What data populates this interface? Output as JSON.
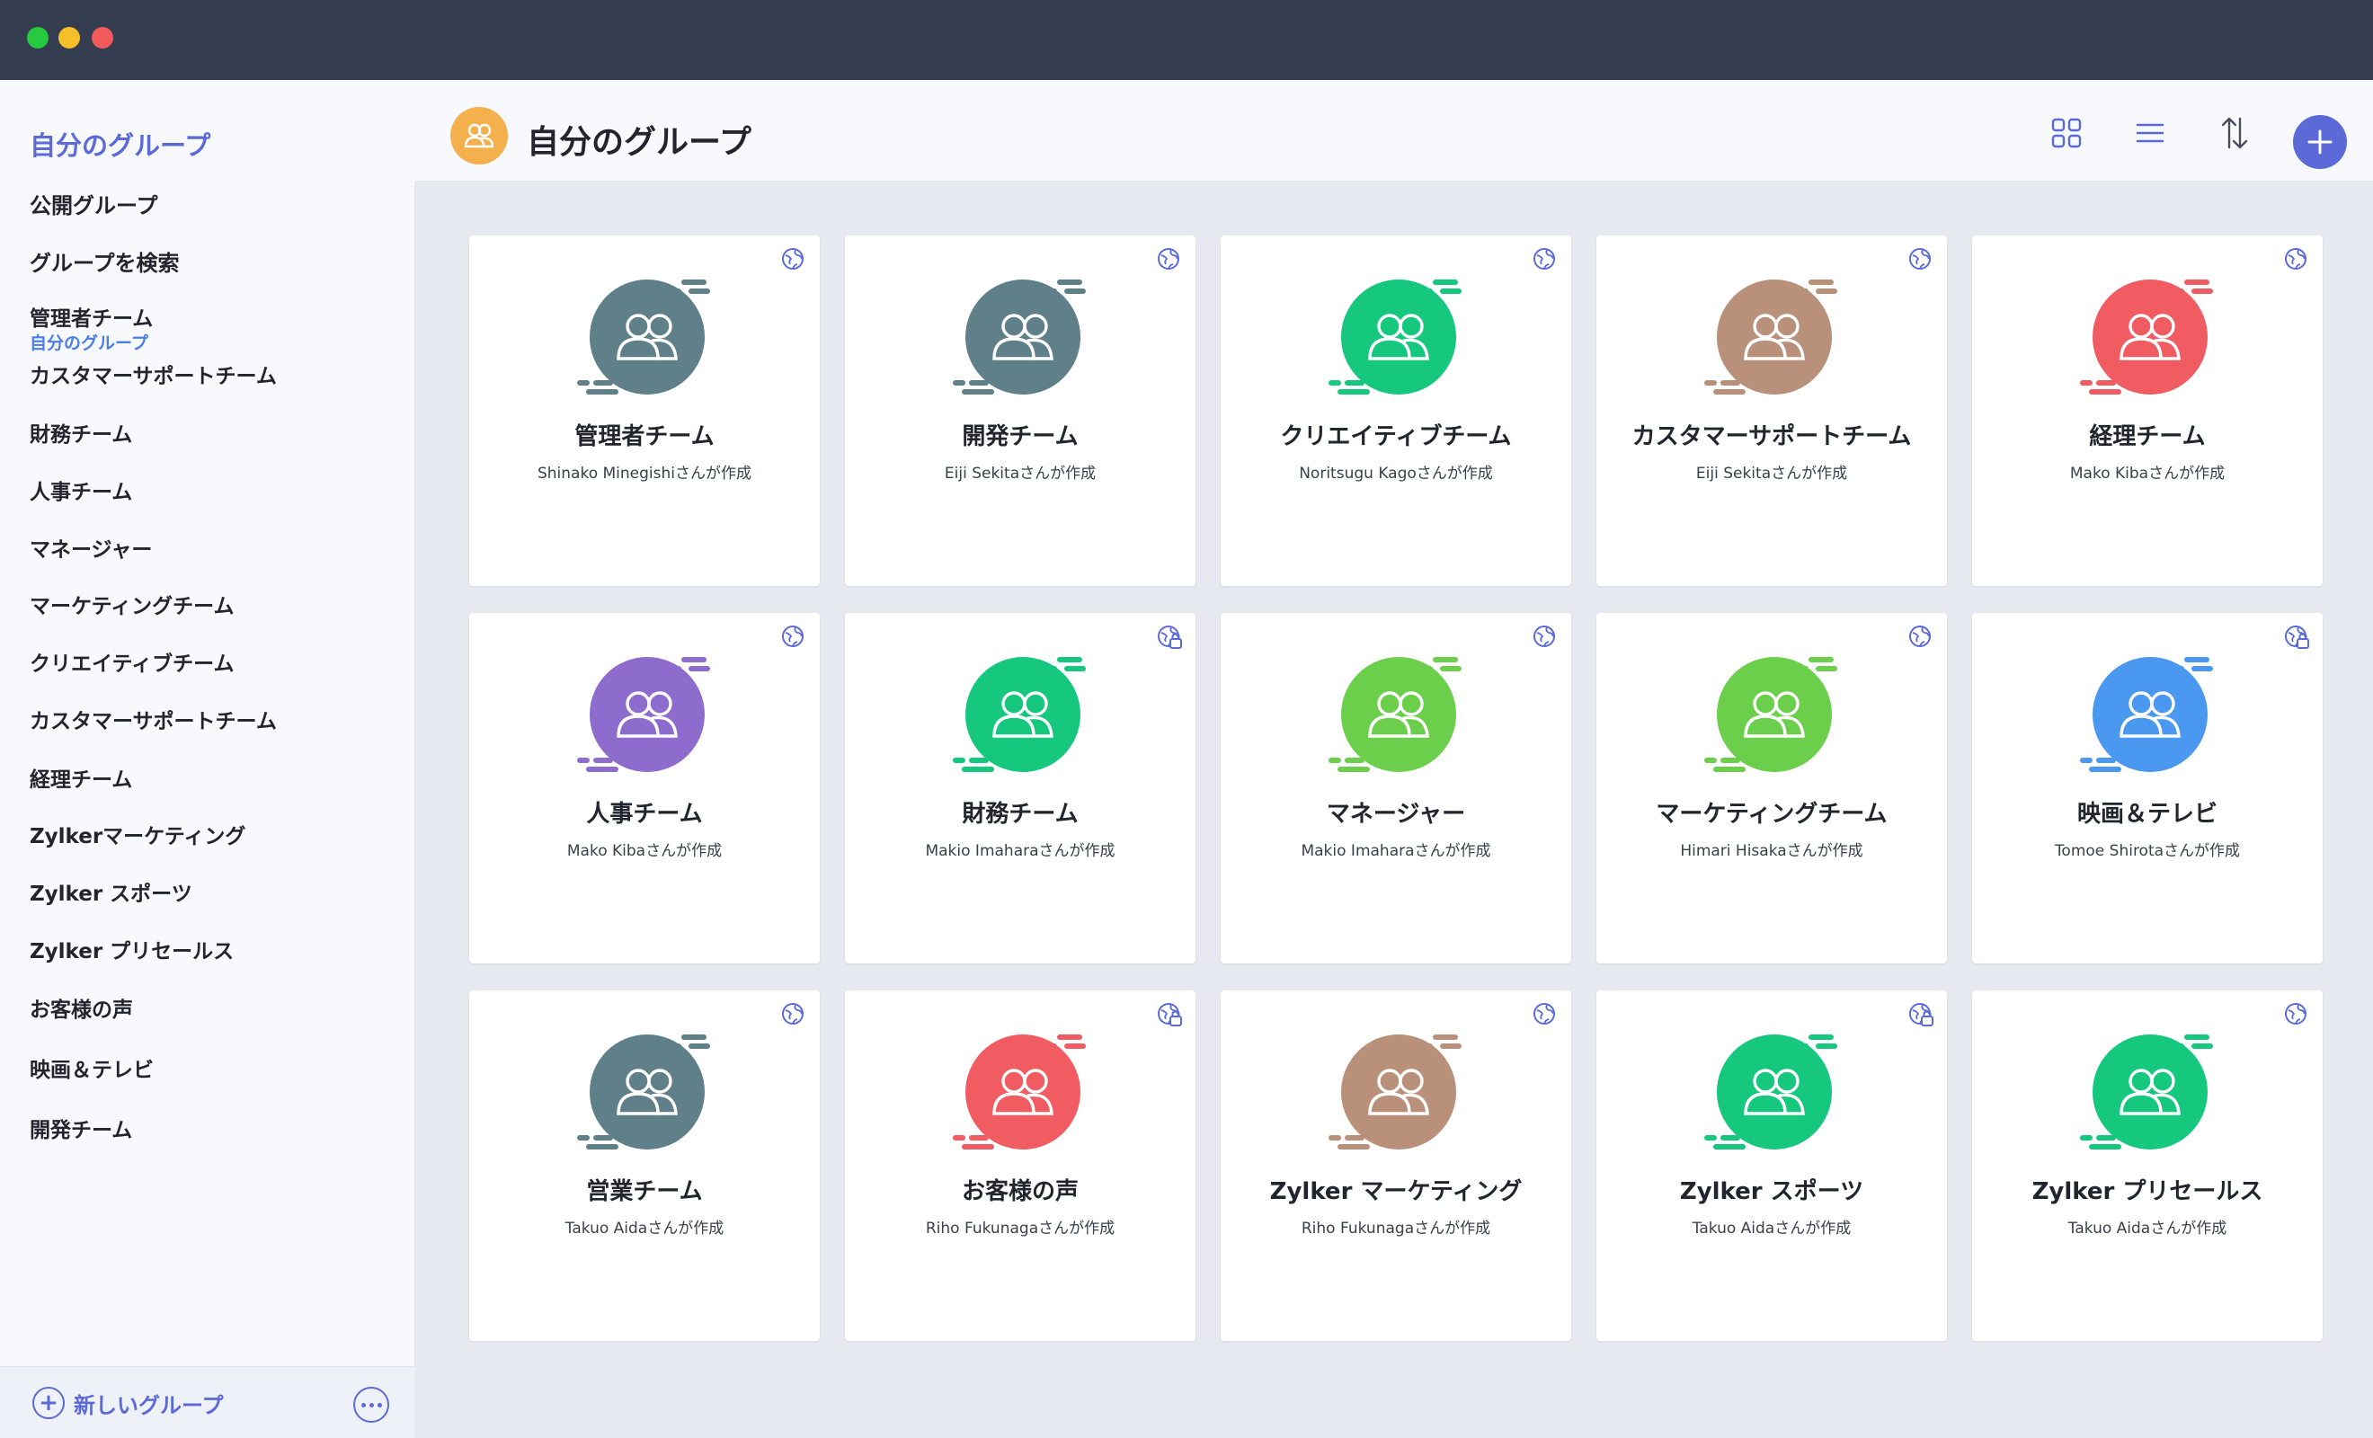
{
  "sidebar": {
    "title": "自分のグループ",
    "links": [
      "公開グループ",
      "グループを検索"
    ],
    "section_label": "自分のグループ",
    "items": [
      "管理者チーム",
      "カスタマーサポートチーム",
      "財務チーム",
      "人事チーム",
      "マネージャー",
      "マーケティングチーム",
      "クリエイティブチーム",
      "カスタマーサポートチーム",
      "経理チーム",
      "Zylkerマーケティング",
      "Zylker スポーツ",
      "Zylker プリセールス",
      "お客様の声",
      "映画＆テレビ",
      "開発チーム"
    ],
    "new_group_label": "新しいグループ"
  },
  "header": {
    "title": "自分のグループ",
    "icons": [
      "people-icon",
      "grid-view-icon",
      "list-view-icon",
      "sort-icon",
      "add-icon"
    ]
  },
  "colors": {
    "accent": "#5b6ad6",
    "slate": "#5f7f89",
    "green": "#16c77e",
    "tan": "#b9917b",
    "red": "#f05c62",
    "purple": "#8e6ccd",
    "lime": "#6ccf4c",
    "blue": "#4a98f0",
    "header_icon": "#f5b04e"
  },
  "groups": [
    {
      "name": "管理者チーム",
      "creator": "Shinako Minegishiさんが作成",
      "color": "#5f7f89",
      "badge": "globe-icon"
    },
    {
      "name": "開発チーム",
      "creator": "Eiji Sekitaさんが作成",
      "color": "#5f7f89",
      "badge": "globe-icon"
    },
    {
      "name": "クリエイティブチーム",
      "creator": "Noritsugu Kagoさんが作成",
      "color": "#16c77e",
      "badge": "globe-icon"
    },
    {
      "name": "カスタマーサポートチーム",
      "creator": "Eiji Sekitaさんが作成",
      "color": "#b9917b",
      "badge": "globe-icon"
    },
    {
      "name": "経理チーム",
      "creator": "Mako Kibaさんが作成",
      "color": "#f05c62",
      "badge": "globe-icon"
    },
    {
      "name": "人事チーム",
      "creator": "Mako Kibaさんが作成",
      "color": "#8e6ccd",
      "badge": "globe-icon"
    },
    {
      "name": "財務チーム",
      "creator": "Makio Imaharaさんが作成",
      "color": "#16c77e",
      "badge": "globe-lock-icon"
    },
    {
      "name": "マネージャー",
      "creator": "Makio Imaharaさんが作成",
      "color": "#6ccf4c",
      "badge": "globe-icon"
    },
    {
      "name": "マーケティングチーム",
      "creator": "Himari Hisakaさんが作成",
      "color": "#6ccf4c",
      "badge": "globe-icon"
    },
    {
      "name": "映画＆テレビ",
      "creator": "Tomoe Shirotaさんが作成",
      "color": "#4a98f0",
      "badge": "globe-lock-icon"
    },
    {
      "name": "営業チーム",
      "creator": "Takuo Aidaさんが作成",
      "color": "#5f7f89",
      "badge": "globe-icon"
    },
    {
      "name": "お客様の声",
      "creator": "Riho Fukunagaさんが作成",
      "color": "#f05c62",
      "badge": "globe-lock-icon"
    },
    {
      "name": "Zylker マーケティング",
      "creator": "Riho Fukunagaさんが作成",
      "color": "#b9917b",
      "badge": "globe-icon"
    },
    {
      "name": "Zylker スポーツ",
      "creator": "Takuo Aidaさんが作成",
      "color": "#16c77e",
      "badge": "globe-lock-icon"
    },
    {
      "name": "Zylker プリセールス",
      "creator": "Takuo Aidaさんが作成",
      "color": "#16c77e",
      "badge": "globe-icon"
    }
  ]
}
